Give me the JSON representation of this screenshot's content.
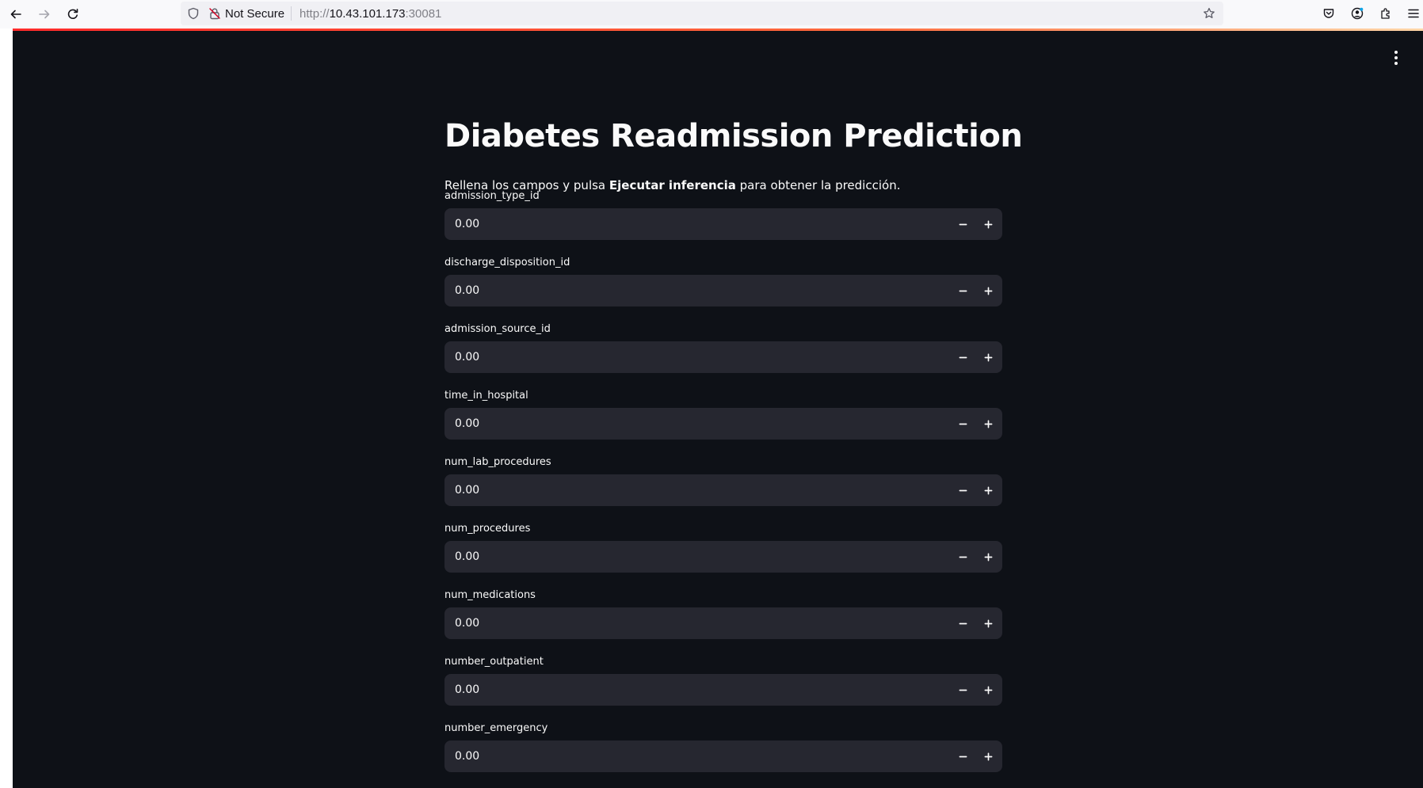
{
  "browser": {
    "security_label": "Not Secure",
    "url_prefix": "http://",
    "url_host": "10.43.101.173",
    "url_port": ":30081"
  },
  "app": {
    "title": "Diabetes Readmission Prediction",
    "intro_before": "Rellena los campos y pulsa ",
    "intro_bold": "Ejecutar inferencia",
    "intro_after": " para obtener la predicción."
  },
  "fields": [
    {
      "label": "admission_type_id",
      "value": "0.00"
    },
    {
      "label": "discharge_disposition_id",
      "value": "0.00"
    },
    {
      "label": "admission_source_id",
      "value": "0.00"
    },
    {
      "label": "time_in_hospital",
      "value": "0.00"
    },
    {
      "label": "num_lab_procedures",
      "value": "0.00"
    },
    {
      "label": "num_procedures",
      "value": "0.00"
    },
    {
      "label": "num_medications",
      "value": "0.00"
    },
    {
      "label": "number_outpatient",
      "value": "0.00"
    },
    {
      "label": "number_emergency",
      "value": "0.00"
    }
  ],
  "icons": {
    "back": "back-arrow-icon",
    "forward": "forward-arrow-icon",
    "reload": "reload-icon",
    "tracking": "shield-icon",
    "insecure": "insecure-lock-icon",
    "bookmark": "star-icon",
    "pocket": "pocket-icon",
    "account": "account-icon",
    "extensions": "puzzle-icon",
    "menu": "hamburger-menu-icon",
    "app_menu": "kebab-menu-icon",
    "decrement": "minus-icon",
    "increment": "plus-icon"
  },
  "colors": {
    "app_background": "#0e1117",
    "input_background": "#262730",
    "text": "#fafafa",
    "accent": "#ff4b4b"
  }
}
